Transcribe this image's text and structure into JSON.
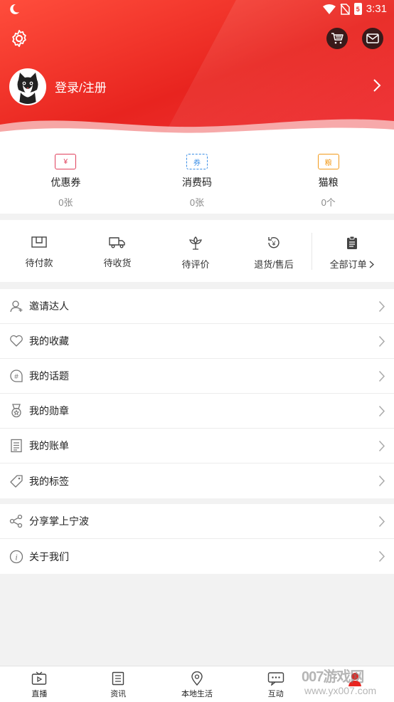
{
  "status_bar": {
    "time": "3:31",
    "battery": "5"
  },
  "profile": {
    "login_text": "登录/注册"
  },
  "stats": [
    {
      "label": "优惠券",
      "value": "0张",
      "icon_text": "¥",
      "color": "#e0405c"
    },
    {
      "label": "消费码",
      "value": "0张",
      "icon_text": "券",
      "color": "#3a8ee6"
    },
    {
      "label": "猫粮",
      "value": "0个",
      "icon_text": "粮",
      "color": "#f29a1a"
    }
  ],
  "orders": [
    {
      "label": "待付款"
    },
    {
      "label": "待收货"
    },
    {
      "label": "待评价"
    },
    {
      "label": "退货/售后"
    },
    {
      "label": "全部订单"
    }
  ],
  "menu_group_1": [
    {
      "label": "邀请达人"
    },
    {
      "label": "我的收藏"
    },
    {
      "label": "我的话题"
    },
    {
      "label": "我的勋章"
    },
    {
      "label": "我的账单"
    },
    {
      "label": "我的标签"
    }
  ],
  "menu_group_2": [
    {
      "label": "分享掌上宁波"
    },
    {
      "label": "关于我们"
    }
  ],
  "tabs": [
    {
      "label": "直播"
    },
    {
      "label": "资讯"
    },
    {
      "label": "本地生活"
    },
    {
      "label": "互动"
    },
    {
      "label": ""
    }
  ],
  "watermark": {
    "line1": "007游戏网",
    "line2": "www.yx007.com"
  },
  "colors": {
    "brand_red": "#e8241f",
    "icon_gray": "#777777"
  }
}
